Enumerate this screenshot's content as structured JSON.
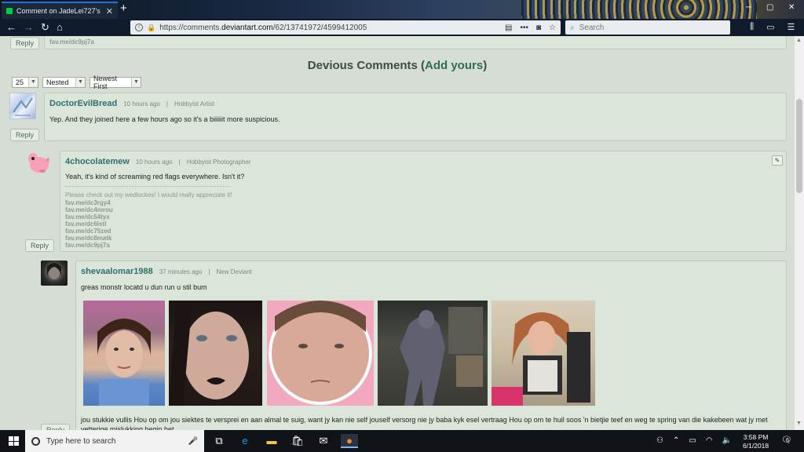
{
  "browser": {
    "tab_title": "Comment on JadeLei727's Sta",
    "url_prefix": "https://comments.",
    "url_domain": "deviantart.com",
    "url_path": "/62/13741972/4599412005",
    "search_placeholder": "Search"
  },
  "page": {
    "top_reply_label": "Reply",
    "top_fav_link": "fav.me/dc9pj7a",
    "heading_prefix": "Devious Comments (",
    "heading_link": "Add yours",
    "heading_suffix": ")",
    "per_page": "25",
    "view_mode": "Nested",
    "sort_order": "Newest First"
  },
  "comments": [
    {
      "username": "DoctorEvilBread",
      "time": "10 hours ago",
      "role": "Hobbyist Artist",
      "text": "Yep. And they joined here a few hours ago so it's a biiiiiit more suspicious.",
      "reply_label": "Reply"
    },
    {
      "username": "4chocolatemew",
      "time": "10 hours ago",
      "role": "Hobbyist Photographer",
      "text": "Yeah, it's kind of screaming red flags everywhere. Isn't it?",
      "signature": "Please check out my wedlockes! I would really appreciate it!",
      "links": [
        "fav.me/dc3rgy4",
        "fav.me/dc4mrou",
        "fav.me/dc54tyx",
        "fav.me/dc6lstl",
        "fav.me/dc75zed",
        "fav.me/dc8matk",
        "fav.me/dc9pj7a"
      ],
      "reply_label": "Reply"
    },
    {
      "username": "shevaalomar1988",
      "time": "37 minutes ago",
      "role": "New Deviant",
      "text": "greas monstr locatd u dun run u stil bum",
      "body": "jou stukkie vullis Hou op om jou siektes te versprei en aan almal te suig, want jy kan nie self jouself versorg nie jy baba kyk esel vertraag Hou op om te huil soos 'n bietjie teef en weg te spring van die kakebeen wat jy met vetterige mislukking begin het",
      "reply_label": "Reply"
    }
  ],
  "taskbar": {
    "search_placeholder": "Type here to search",
    "time": "3:58 PM",
    "date": "6/1/2018",
    "notification_count": "6"
  },
  "colors": {
    "page_bg": "#d5ddd4",
    "username": "#2f6f6b",
    "accent_link": "#2e6f4f"
  }
}
